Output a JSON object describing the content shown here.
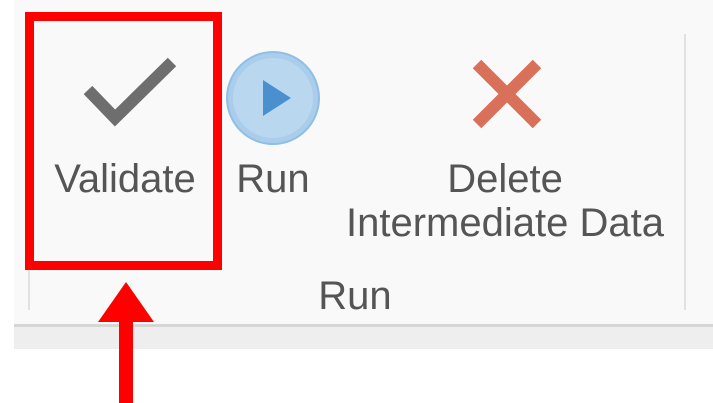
{
  "ribbon": {
    "buttons": {
      "validate": {
        "label": "Validate",
        "icon": "checkmark-icon"
      },
      "run": {
        "label": "Run",
        "icon": "play-icon"
      },
      "delete": {
        "label_line1": "Delete",
        "label_line2": "Intermediate Data",
        "icon": "delete-x-icon"
      }
    },
    "group_label": "Run"
  },
  "colors": {
    "highlight": "#ff0000",
    "check": "#6e6e6e",
    "play_fill": "#a9cdea",
    "play_triangle": "#4a90cf",
    "delete_x": "#d9705a",
    "label_text": "#555555"
  }
}
